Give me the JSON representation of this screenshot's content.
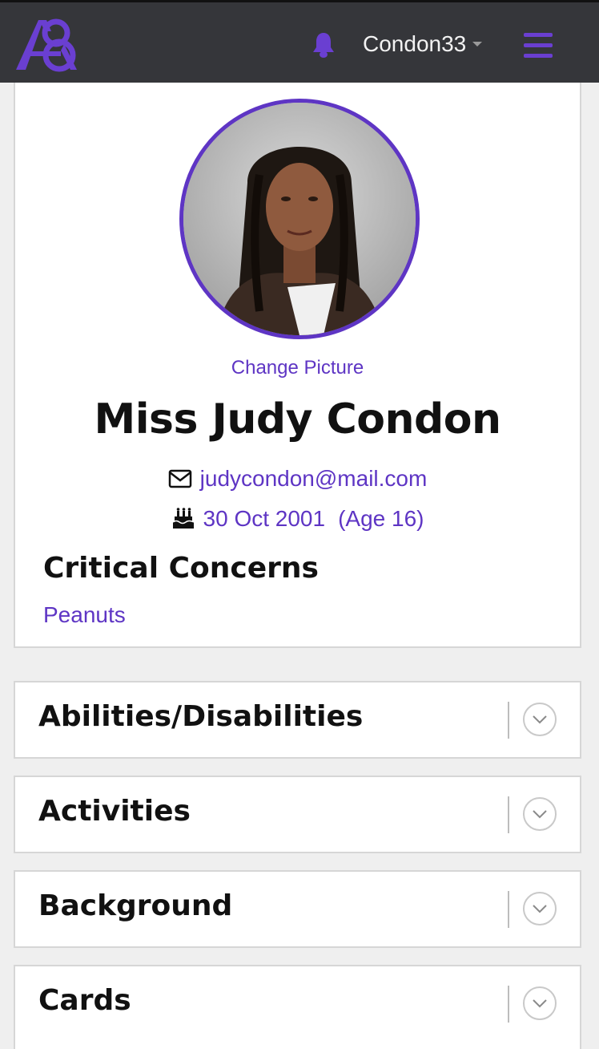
{
  "header": {
    "logo_alt": "AB",
    "username": "Condon33",
    "icons": {
      "notifications": "bell-icon",
      "menu": "hamburger-menu-icon",
      "dropdown": "caret-down-icon"
    }
  },
  "profile": {
    "change_picture_label": "Change Picture",
    "full_name": "Miss Judy Condon",
    "email": "judycondon@mail.com",
    "date_of_birth": "30 Oct 2001",
    "age_text": "(Age 16)",
    "critical_concerns_title": "Critical Concerns",
    "critical_concerns": [
      "Peanuts"
    ]
  },
  "sections": [
    {
      "title": "Abilities/Disabilities"
    },
    {
      "title": "Activities"
    },
    {
      "title": "Background"
    },
    {
      "title": "Cards"
    }
  ],
  "colors": {
    "accent": "#5e35c4",
    "topbar": "#35363a",
    "page_bg": "#efefef"
  }
}
